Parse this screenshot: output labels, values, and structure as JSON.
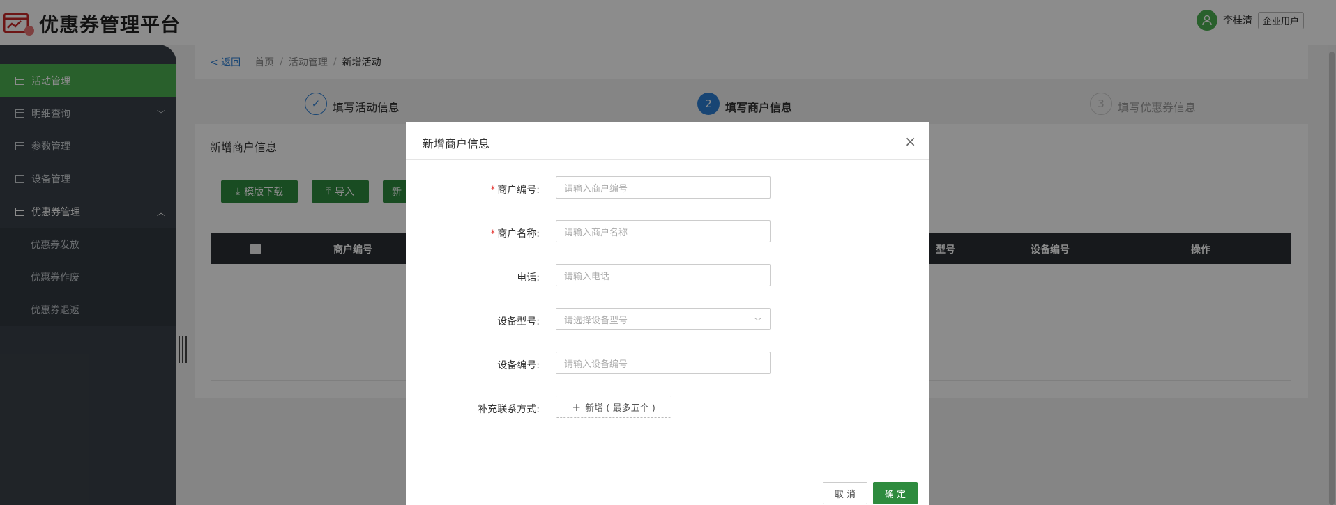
{
  "app": {
    "title": "优惠券管理平台"
  },
  "user": {
    "name": "李桂清",
    "role": "企业用户",
    "avatar_icon": "user-icon"
  },
  "sidebar": {
    "items": [
      {
        "label": "活动管理",
        "icon": "table-icon",
        "active": true
      },
      {
        "label": "明细查询",
        "icon": "table-icon",
        "chevron": "﹀"
      },
      {
        "label": "参数管理",
        "icon": "table-icon"
      },
      {
        "label": "设备管理",
        "icon": "table-icon"
      },
      {
        "label": "优惠券管理",
        "icon": "table-icon",
        "chevron": "︿"
      }
    ],
    "subitems": [
      "优惠券发放",
      "优惠券作废",
      "优惠券退返"
    ]
  },
  "breadcrumb": {
    "back": "< 返回",
    "items": [
      "首页",
      "活动管理",
      "新增活动"
    ]
  },
  "steps": [
    {
      "num": "✓",
      "label": "填写活动信息",
      "state": "done"
    },
    {
      "num": "2",
      "label": "填写商户信息",
      "state": "active"
    },
    {
      "num": "3",
      "label": "填写优惠券信息",
      "state": "pending"
    }
  ],
  "panel": {
    "title": "新增商户信息",
    "buttons": {
      "template_download": "模版下载",
      "import": "导入",
      "new": "新"
    },
    "table_headers": [
      "商户编号",
      "型号",
      "设备编号",
      "操作"
    ]
  },
  "modal": {
    "title": "新增商户信息",
    "close": "×",
    "fields": [
      {
        "label": "商户编号:",
        "required": true,
        "placeholder": "请输入商户编号"
      },
      {
        "label": "商户名称:",
        "required": true,
        "placeholder": "请输入商户名称"
      },
      {
        "label": "电话:",
        "required": false,
        "placeholder": "请输入电话"
      },
      {
        "label": "设备型号:",
        "required": false,
        "placeholder": "请选择设备型号",
        "type": "select"
      },
      {
        "label": "设备编号:",
        "required": false,
        "placeholder": "请输入设备编号"
      },
      {
        "label": "补充联系方式:",
        "required": false
      }
    ],
    "add_contact": "新增 ( 最多五个 )",
    "cancel": "取 消",
    "ok": "确 定"
  },
  "colors": {
    "primary_green": "#2e8b3e",
    "active_menu": "#4caf50",
    "sidebar_bg": "#3a4149",
    "step_blue": "#2d7fd3"
  }
}
